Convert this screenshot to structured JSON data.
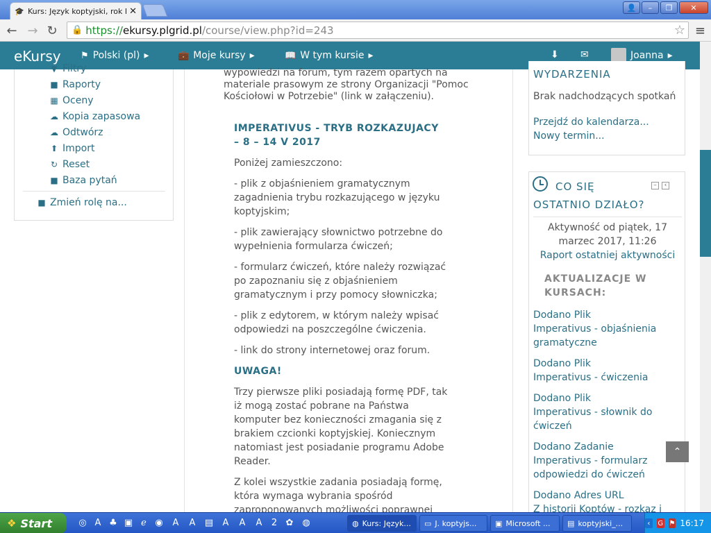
{
  "browser": {
    "tab_title": "Kurs: Język koptyjski, rok I, ...",
    "url_scheme": "https://",
    "url_host": "ekursy.plgrid.pl",
    "url_path": "/course/view.php?id=243"
  },
  "sitenav": {
    "brand": "eKursy",
    "language": "Polski (pl)",
    "my_courses": "Moje kursy",
    "this_course": "W tym kursie",
    "user": "Joanna"
  },
  "left_menu": {
    "items": [
      {
        "label": "Filtry",
        "icon": "filter-icon"
      },
      {
        "label": "Raporty",
        "icon": "folder-icon"
      },
      {
        "label": "Oceny",
        "icon": "table-icon"
      },
      {
        "label": "Kopia zapasowa",
        "icon": "cloud-upload-icon"
      },
      {
        "label": "Odtwórz",
        "icon": "cloud-download-icon"
      },
      {
        "label": "Import",
        "icon": "upload-icon"
      },
      {
        "label": "Reset",
        "icon": "refresh-icon"
      },
      {
        "label": "Baza pytań",
        "icon": "folder-icon"
      }
    ],
    "switch_role": "Zmień rolę na..."
  },
  "main": {
    "intro": "wypowiedzi na forum, tym razem opartych na materiale prasowym ze strony Organizacji \"Pomoc Kościołowi w Potrzebie\" (link w załączeniu).",
    "heading_line1": "IMPERATIVUS - TRYB ROZKAZUJACY",
    "heading_line2": "– 8 – 14 V 2017",
    "p1": "Poniżej zamieszczono:",
    "p2": "- plik z objaśnieniem gramatycznym zagadnienia trybu rozkazującego w języku koptyjskim;",
    "p3": "- plik zawierający słownictwo potrzebne do wypełnienia formularza ćwiczeń;",
    "p4": "- formularz ćwiczeń, które należy rozwiązać po zapoznaniu się z objaśnieniem gramatycznym i przy pomocy słowniczka;",
    "p5": "- plik z edytorem, w którym należy wpisać odpowiedzi na poszczególne ćwiczenia.",
    "p6": "- link do strony internetowej oraz forum.",
    "warning": "UWAGA!",
    "p7": "Trzy pierwsze pliki posiadają formę PDF, tak iż mogą zostać pobrane na Państwa komputer bez konieczności zmagania się z brakiem czcionki koptyjskiej. Koniecznym natomiast jest posiadanie programu Adobe Reader.",
    "p8": "Z kolei wszystkie zadania posiadają formę, która wymaga wybrania spośród zaproponowanych możliwości poprawnej"
  },
  "events_block": {
    "title": "WYDARZENIA",
    "none": "Brak nadchodzących spotkań",
    "calendar": "Przejdź do kalendarza...",
    "new_event": "Nowy termin..."
  },
  "recent_block": {
    "title_line1": "CO SIĘ",
    "title_line2": "OSTATNIO DZIAŁO?",
    "since": "Aktywność od piątek, 17 marzec 2017, 11:26",
    "report": "Raport ostatniej aktywności",
    "updates_title": "AKTUALIZACJE W KURSACH:",
    "updates": [
      {
        "type": "Dodano Plik",
        "name": "Imperativus - objaśnienia gramatyczne"
      },
      {
        "type": "Dodano Plik",
        "name": "Imperativus - ćwiczenia"
      },
      {
        "type": "Dodano Plik",
        "name": "Imperativus - słownik do ćwiczeń"
      },
      {
        "type": "Dodano Zadanie",
        "name": "Imperativus - formularz odpowiedzi do ćwiczeń"
      },
      {
        "type": "Dodano Adres URL",
        "name": "Z historii Koptów - rozkaz i"
      }
    ]
  },
  "taskbar": {
    "start": "Start",
    "tasks": [
      "Kurs: Język...",
      "J. koptyjs...",
      "Microsoft ...",
      "koptyjski_..."
    ],
    "clock": "16:17"
  }
}
